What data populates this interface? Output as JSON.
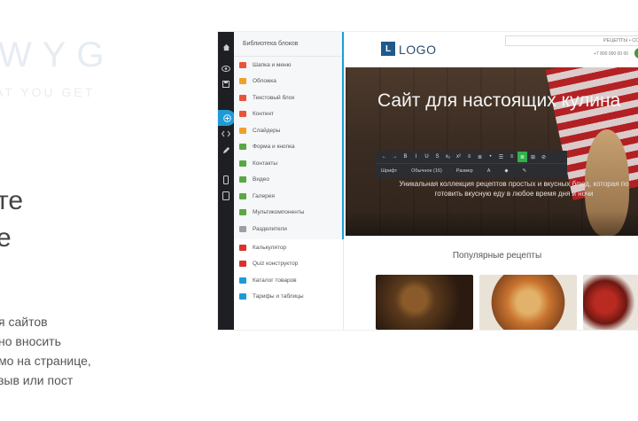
{
  "marketing": {
    "wyg_big": "WYG",
    "wyg_sub": "AT YOU GET",
    "headline_line1": "те",
    "headline_line2": "е",
    "desc_lines": [
      "я сайтов",
      "но вносить",
      "мо на странице,",
      "зыв или пост"
    ]
  },
  "editor": {
    "rail_icons": [
      "home-icon",
      "eye-icon",
      "save-icon",
      "add-icon",
      "code-icon",
      "pencil-icon",
      "mobile-icon",
      "tablet-icon"
    ],
    "library": {
      "title": "Библиотека блоков",
      "items": [
        {
          "label": "Шапка и меню",
          "color": "#e8543a"
        },
        {
          "label": "Обложка",
          "color": "#f0a02a"
        },
        {
          "label": "Текстовый блок",
          "color": "#e8543a"
        },
        {
          "label": "Контент",
          "color": "#e8543a"
        },
        {
          "label": "Слайдеры",
          "color": "#f0a02a"
        },
        {
          "label": "Форма и кнопка",
          "color": "#5aa843"
        },
        {
          "label": "Контакты",
          "color": "#5aa843"
        },
        {
          "label": "Видео",
          "color": "#5aa843"
        },
        {
          "label": "Галерея",
          "color": "#5aa843"
        },
        {
          "label": "Мультикомпоненты",
          "color": "#5aa843"
        },
        {
          "label": "Разделители",
          "color": "#9aa0a6"
        },
        {
          "label": "Калькулятор",
          "color": "#d6342c"
        },
        {
          "label": "Quiz конструктор",
          "color": "#d6342c"
        },
        {
          "label": "Каталог товаров",
          "color": "#1e9bd7"
        },
        {
          "label": "Тарифы и таблицы",
          "color": "#1e9bd7"
        }
      ]
    }
  },
  "site": {
    "logo_letter": "L",
    "logo_text": "LOGO",
    "top_nav_text": "РЕЦЕПТЫ • СО",
    "phone": "+7 800 000 00 00",
    "hero_title": "Сайт для настоящих кулина",
    "toolbar_icons": [
      "←",
      "→",
      "B",
      "I",
      "U",
      "S",
      "x₂",
      "x²",
      "≡",
      "≣",
      "•",
      "☰",
      "≡",
      "≣",
      "⊞",
      "⊘"
    ],
    "toolbar_active_index": 13,
    "toolbar_selects": [
      "Шрифт",
      "Обычное (16)",
      "Размер",
      "A",
      "◆",
      "✎"
    ],
    "hero_sub_line1": "Уникальная коллекция рецептов простых и вкусных блюд, которая по",
    "hero_sub_line2": "готовить вкусную еду в любое время дня и ночи",
    "section_title": "Популярные рецепты"
  }
}
